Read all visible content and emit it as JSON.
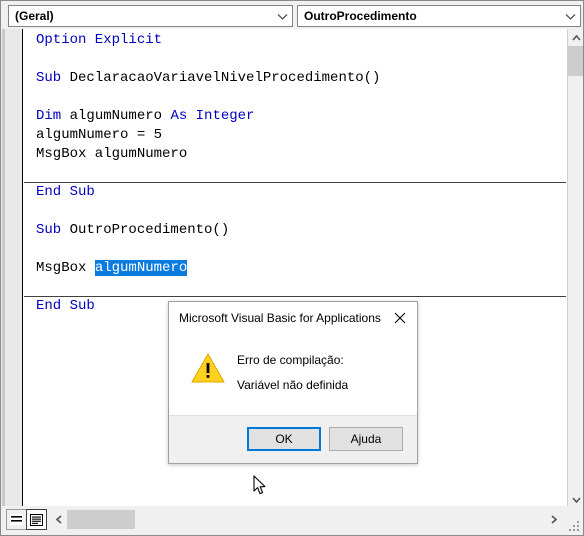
{
  "combo_bar": {
    "object_combo": {
      "value": "(Geral)",
      "icon": "chevron-down-icon"
    },
    "procedure_combo": {
      "value": "OutroProcedimento",
      "icon": "chevron-down-icon"
    }
  },
  "code": {
    "lines": [
      [
        {
          "t": "Option Explicit",
          "s": "kw"
        }
      ],
      [],
      [
        {
          "t": "Sub ",
          "s": "kw"
        },
        {
          "t": "DeclaracaoVariavelNivelProcedimento()",
          "s": "plain"
        }
      ],
      [],
      [
        {
          "t": "Dim ",
          "s": "kw"
        },
        {
          "t": "algumNumero ",
          "s": "plain"
        },
        {
          "t": "As Integer",
          "s": "kw"
        }
      ],
      [
        {
          "t": "algumNumero = 5",
          "s": "plain"
        }
      ],
      [
        {
          "t": "MsgBox algumNumero",
          "s": "plain"
        }
      ],
      [],
      [
        {
          "t": "End Sub",
          "s": "kw"
        }
      ],
      [],
      [
        {
          "t": "Sub ",
          "s": "kw"
        },
        {
          "t": "OutroProcedimento()",
          "s": "plain"
        }
      ],
      [],
      [
        {
          "t": "MsgBox ",
          "s": "plain"
        },
        {
          "t": "algumNumero",
          "s": "sel"
        }
      ],
      [],
      [
        {
          "t": "End Sub",
          "s": "kw"
        }
      ]
    ],
    "separator_after_lines": [
      8,
      14
    ],
    "keyword_color": "#0000c0",
    "selection_bg": "#0a7ce0",
    "selection_fg": "#ffffff"
  },
  "scrollbars": {
    "vertical": {
      "up_icon": "chevron-up-icon",
      "down_icon": "chevron-down-icon"
    },
    "horizontal": {
      "left_icon": "chevron-left-icon",
      "right_icon": "chevron-right-icon"
    },
    "resize_grip_icon": "resize-grip-icon"
  },
  "bottom_bar": {
    "procedure_view_button": {
      "icon": "procedure-view-icon",
      "selected": false
    },
    "full_module_view_button": {
      "icon": "full-module-view-icon",
      "selected": true
    }
  },
  "dialog": {
    "title": "Microsoft Visual Basic for Applications",
    "close_icon": "close-icon",
    "warning_icon": "warning-triangle-icon",
    "message_line1": "Erro de compilação:",
    "message_line2": "Variável não definida",
    "buttons": {
      "ok": "OK",
      "help": "Ajuda"
    },
    "focus_color": "#0078d7",
    "warning_color": "#ffd21e"
  },
  "cursor": {
    "icon": "mouse-pointer-icon"
  }
}
